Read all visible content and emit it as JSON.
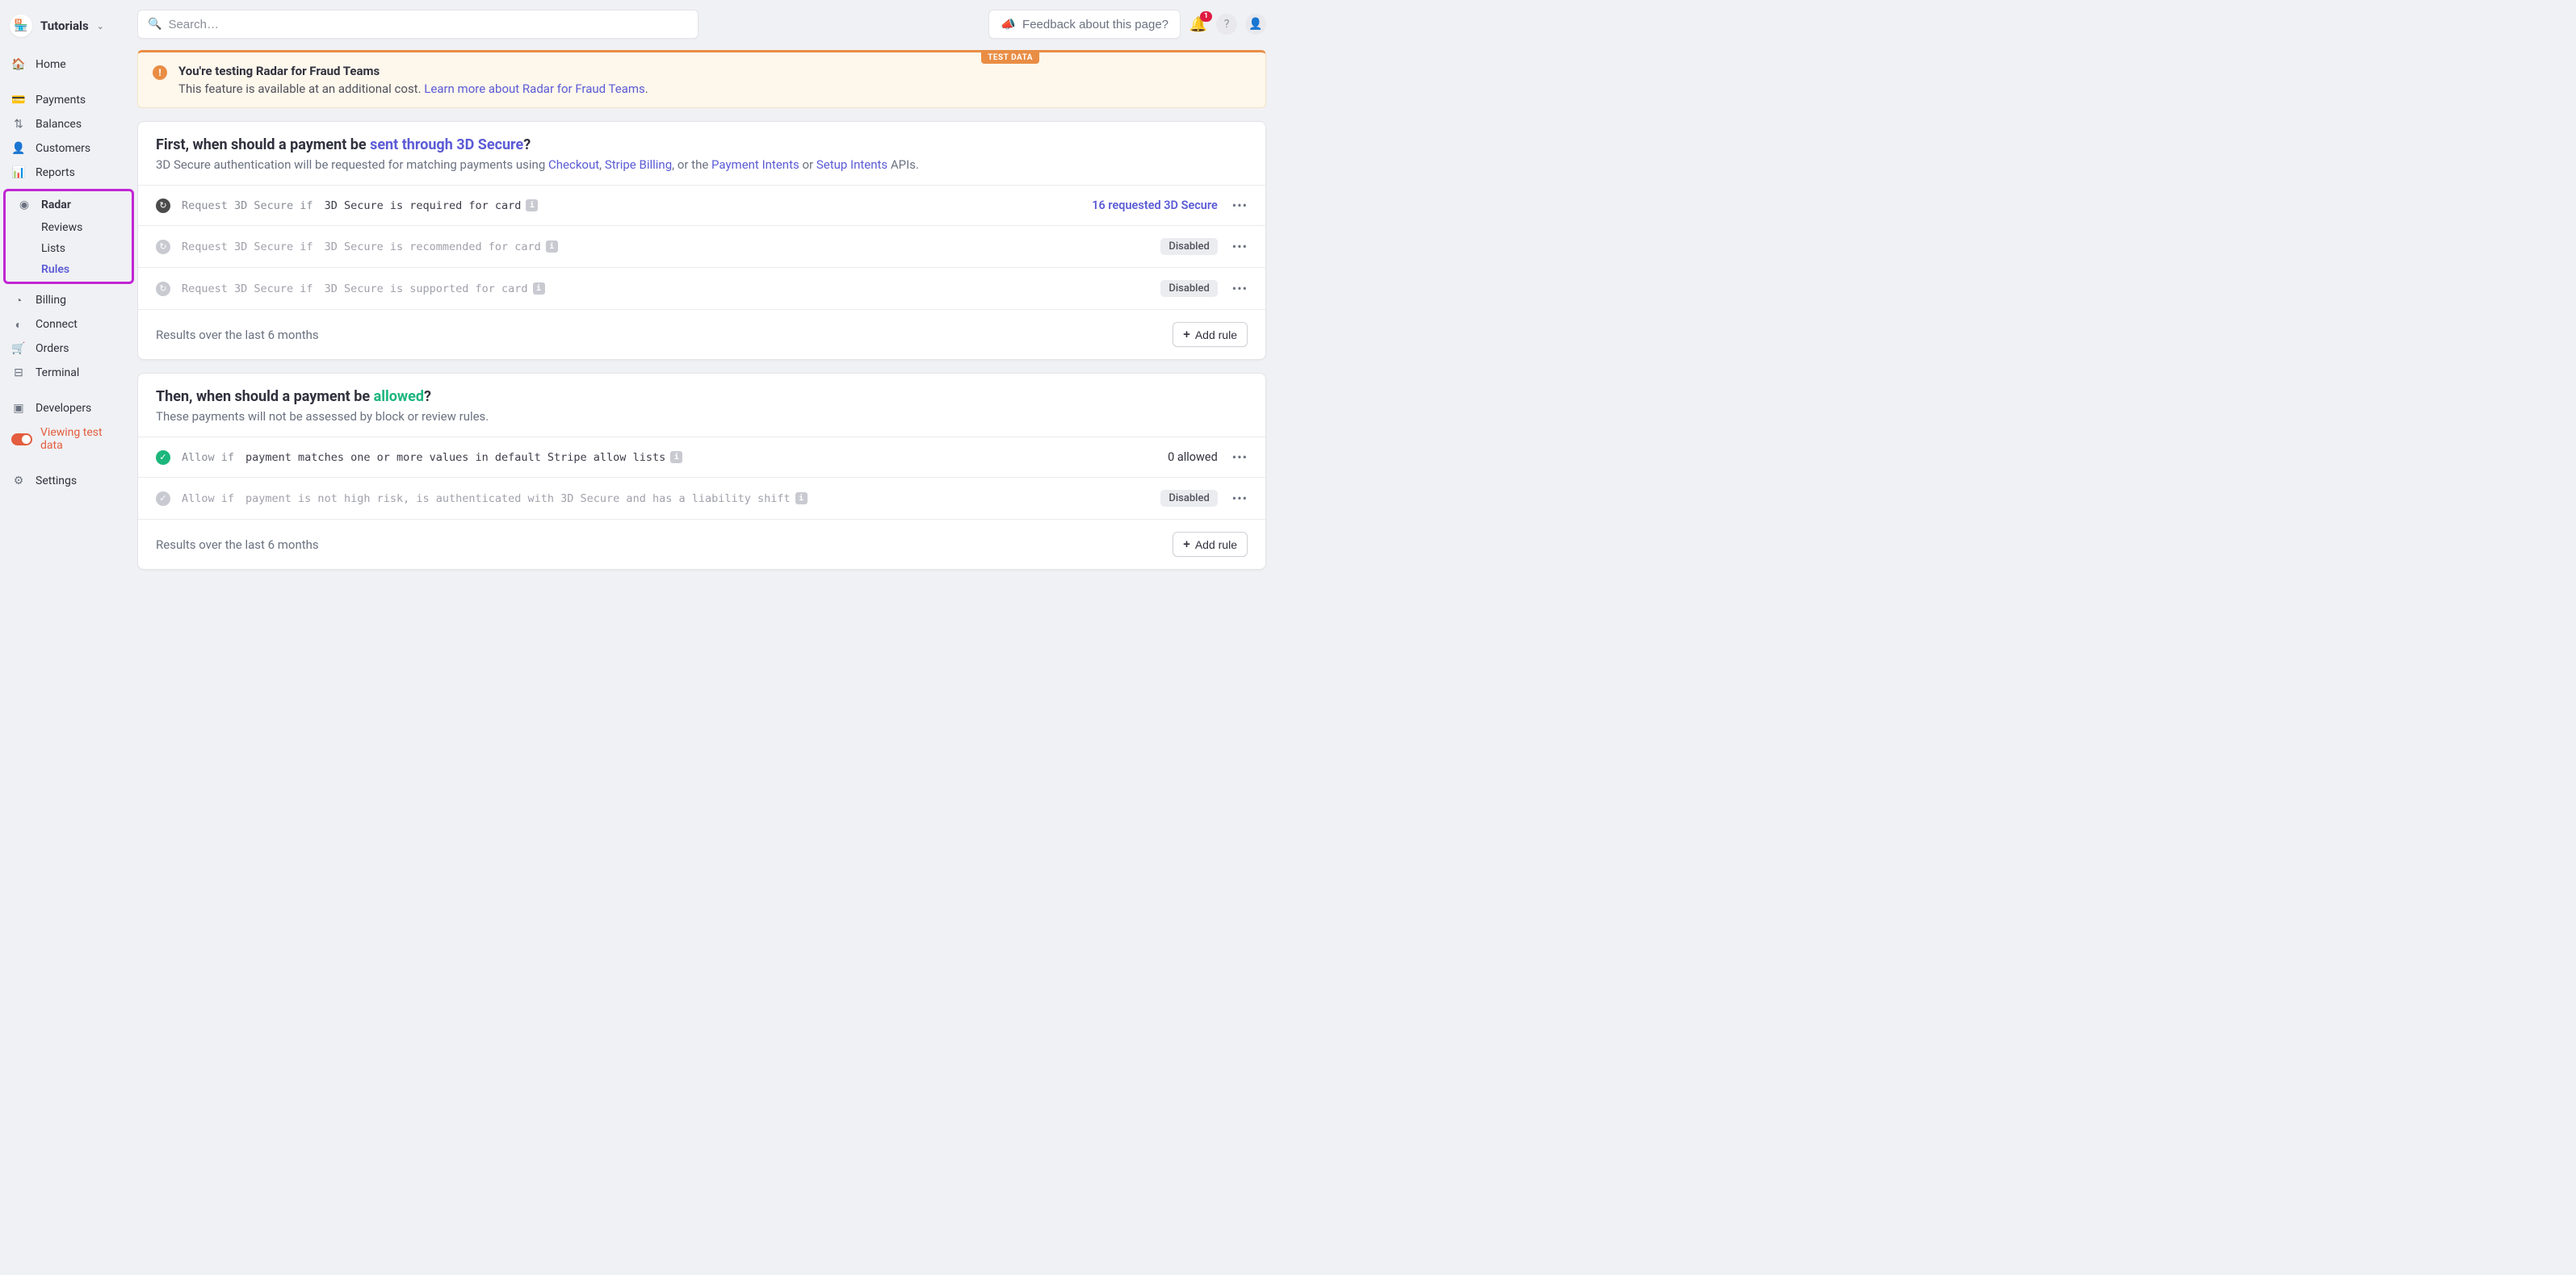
{
  "brand": {
    "title": "Tutorials"
  },
  "search": {
    "placeholder": "Search…"
  },
  "feedback": {
    "label": "Feedback about this page?"
  },
  "notifications": {
    "count": "1"
  },
  "nav": {
    "home": "Home",
    "payments": "Payments",
    "balances": "Balances",
    "customers": "Customers",
    "reports": "Reports",
    "radar": "Radar",
    "radar_sub": {
      "reviews": "Reviews",
      "lists": "Lists",
      "rules": "Rules"
    },
    "billing": "Billing",
    "connect": "Connect",
    "orders": "Orders",
    "terminal": "Terminal",
    "developers": "Developers",
    "test_toggle": "Viewing test data",
    "settings": "Settings"
  },
  "banner": {
    "test_pill": "TEST DATA",
    "title": "You're testing Radar for Fraud Teams",
    "desc_prefix": "This feature is available at an additional cost. ",
    "link": "Learn more about Radar for Fraud Teams",
    "desc_suffix": "."
  },
  "card1": {
    "title_prefix": "First, when should a payment be ",
    "title_highlight": "sent through 3D Secure",
    "title_suffix": "?",
    "desc_prefix": "3D Secure authentication will be requested for matching payments using ",
    "link1": "Checkout",
    "sep1": ", ",
    "link2": "Stripe Billing",
    "sep2": ", or the ",
    "link3": "Payment Intents",
    "sep3": " or ",
    "link4": "Setup Intents",
    "desc_suffix": " APIs.",
    "rules": [
      {
        "prefix": "Request 3D Secure if",
        "body": "3D Secure is required for card",
        "stat": "16 requested 3D Secure",
        "disabled": false
      },
      {
        "prefix": "Request 3D Secure if",
        "body": "3D Secure is recommended for card",
        "stat": "",
        "disabled": true
      },
      {
        "prefix": "Request 3D Secure if",
        "body": "3D Secure is supported for card",
        "stat": "",
        "disabled": true
      }
    ],
    "footer": "Results over the last 6 months",
    "add_rule": "Add rule"
  },
  "card2": {
    "title_prefix": "Then, when should a payment be ",
    "title_highlight": "allowed",
    "title_suffix": "?",
    "desc": "These payments will not be assessed by block or review rules.",
    "rules": [
      {
        "prefix": "Allow if",
        "body": "payment matches one or more values in default Stripe allow lists",
        "stat": "0 allowed",
        "disabled": false
      },
      {
        "prefix": "Allow if",
        "body": "payment is not high risk, is authenticated with 3D Secure and has a liability shift",
        "stat": "",
        "disabled": true
      }
    ],
    "footer": "Results over the last 6 months",
    "add_rule": "Add rule"
  },
  "disabled_label": "Disabled"
}
